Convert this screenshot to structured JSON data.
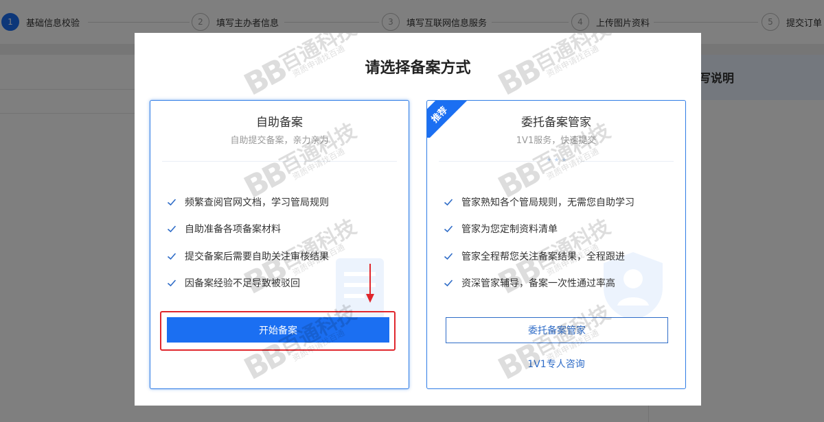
{
  "steps": [
    {
      "num": "1",
      "label": "基础信息校验"
    },
    {
      "num": "2",
      "label": "填写主办者信息"
    },
    {
      "num": "3",
      "label": "填写互联网信息服务"
    },
    {
      "num": "4",
      "label": "上传图片资料"
    },
    {
      "num": "5",
      "label": "提交订单"
    }
  ],
  "background": {
    "right_panel_title": "写说明"
  },
  "modal": {
    "title": "请选择备案方式",
    "self_service": {
      "title": "自助备案",
      "subtitle": "自助提交备案，亲力亲为",
      "features": [
        "频繁查阅官网文档，学习管局规则",
        "自助准备各项备案材料",
        "提交备案后需要自助关注审核结果",
        "因备案经验不足导致被驳回"
      ],
      "button": "开始备案"
    },
    "managed": {
      "badge": "推荐",
      "title": "委托备案管家",
      "subtitle": "1V1服务，快速提交",
      "features": [
        "管家熟知各个管局规则，无需您自助学习",
        "管家为您定制资料清单",
        "管家全程帮您关注备案结果，全程跟进",
        "资深管家辅导，备案一次性通过率高"
      ],
      "button": "委托备案管家",
      "link": "1V1专人咨询"
    }
  },
  "watermark": {
    "logo": "BB",
    "name": "百通科技",
    "sub": "资质申请找百通"
  },
  "colors": {
    "primary": "#1b6ff2",
    "link": "#2d6bc7",
    "highlight": "#e0262c"
  }
}
